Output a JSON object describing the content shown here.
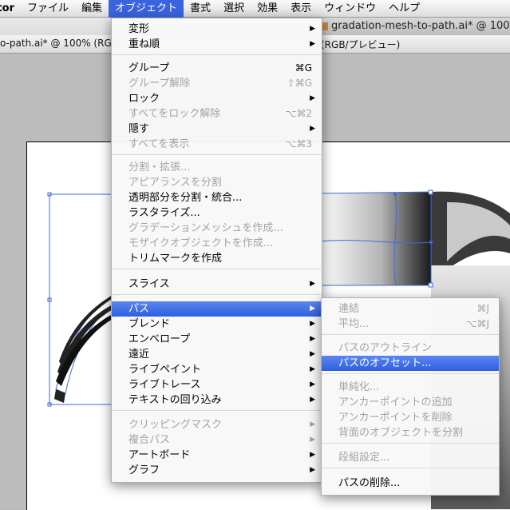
{
  "menubar": {
    "app": "Illustrator",
    "items": [
      "ファイル",
      "編集",
      "オブジェクト",
      "書式",
      "選択",
      "効果",
      "表示",
      "ウィンドウ",
      "ヘルプ"
    ]
  },
  "tabs": {
    "back_title": "gradation-mesh-to-path.ai* @ 100%",
    "front_title": "o-path.ai* @ 100% (RGB/",
    "front_title2": "(RGB/プレビュー)"
  },
  "object_menu": [
    {
      "label": "変形",
      "submenu": true
    },
    {
      "label": "重ね順",
      "submenu": true
    },
    {
      "sep": true
    },
    {
      "label": "グループ",
      "shortcut": "⌘G"
    },
    {
      "label": "グループ解除",
      "shortcut": "⇧⌘G",
      "disabled": true
    },
    {
      "label": "ロック",
      "submenu": true
    },
    {
      "label": "すべてをロック解除",
      "shortcut": "⌥⌘2",
      "disabled": true
    },
    {
      "label": "隠す",
      "submenu": true
    },
    {
      "label": "すべてを表示",
      "shortcut": "⌥⌘3",
      "disabled": true
    },
    {
      "sep": true
    },
    {
      "label": "分割・拡張...",
      "disabled": true
    },
    {
      "label": "アピアランスを分割",
      "disabled": true
    },
    {
      "label": "透明部分を分割・統合..."
    },
    {
      "label": "ラスタライズ..."
    },
    {
      "label": "グラデーションメッシュを作成...",
      "disabled": true
    },
    {
      "label": "モザイクオブジェクトを作成...",
      "disabled": true
    },
    {
      "label": "トリムマークを作成"
    },
    {
      "sep": true
    },
    {
      "label": "スライス",
      "submenu": true
    },
    {
      "sep": true
    },
    {
      "label": "パス",
      "submenu": true,
      "highlighted": true
    },
    {
      "label": "ブレンド",
      "submenu": true
    },
    {
      "label": "エンベロープ",
      "submenu": true
    },
    {
      "label": "遠近",
      "submenu": true
    },
    {
      "label": "ライブペイント",
      "submenu": true
    },
    {
      "label": "ライブトレース",
      "submenu": true
    },
    {
      "label": "テキストの回り込み",
      "submenu": true
    },
    {
      "sep": true
    },
    {
      "label": "クリッピングマスク",
      "submenu": true,
      "disabled": true
    },
    {
      "label": "複合パス",
      "submenu": true,
      "disabled": true
    },
    {
      "label": "アートボード",
      "submenu": true
    },
    {
      "label": "グラフ",
      "submenu": true
    }
  ],
  "path_submenu": [
    {
      "label": "連結",
      "shortcut": "⌘J",
      "disabled": true
    },
    {
      "label": "平均...",
      "shortcut": "⌥⌘J",
      "disabled": true
    },
    {
      "sep": true
    },
    {
      "label": "パスのアウトライン",
      "disabled": true
    },
    {
      "label": "パスのオフセット...",
      "highlighted": true
    },
    {
      "sep": true
    },
    {
      "label": "単純化...",
      "disabled": true
    },
    {
      "label": "アンカーポイントの追加",
      "disabled": true
    },
    {
      "label": "アンカーポイントを削除",
      "disabled": true
    },
    {
      "label": "背面のオブジェクトを分割",
      "disabled": true
    },
    {
      "sep": true
    },
    {
      "label": "段組設定...",
      "disabled": true
    },
    {
      "sep": true
    },
    {
      "label": "パスの削除..."
    }
  ]
}
